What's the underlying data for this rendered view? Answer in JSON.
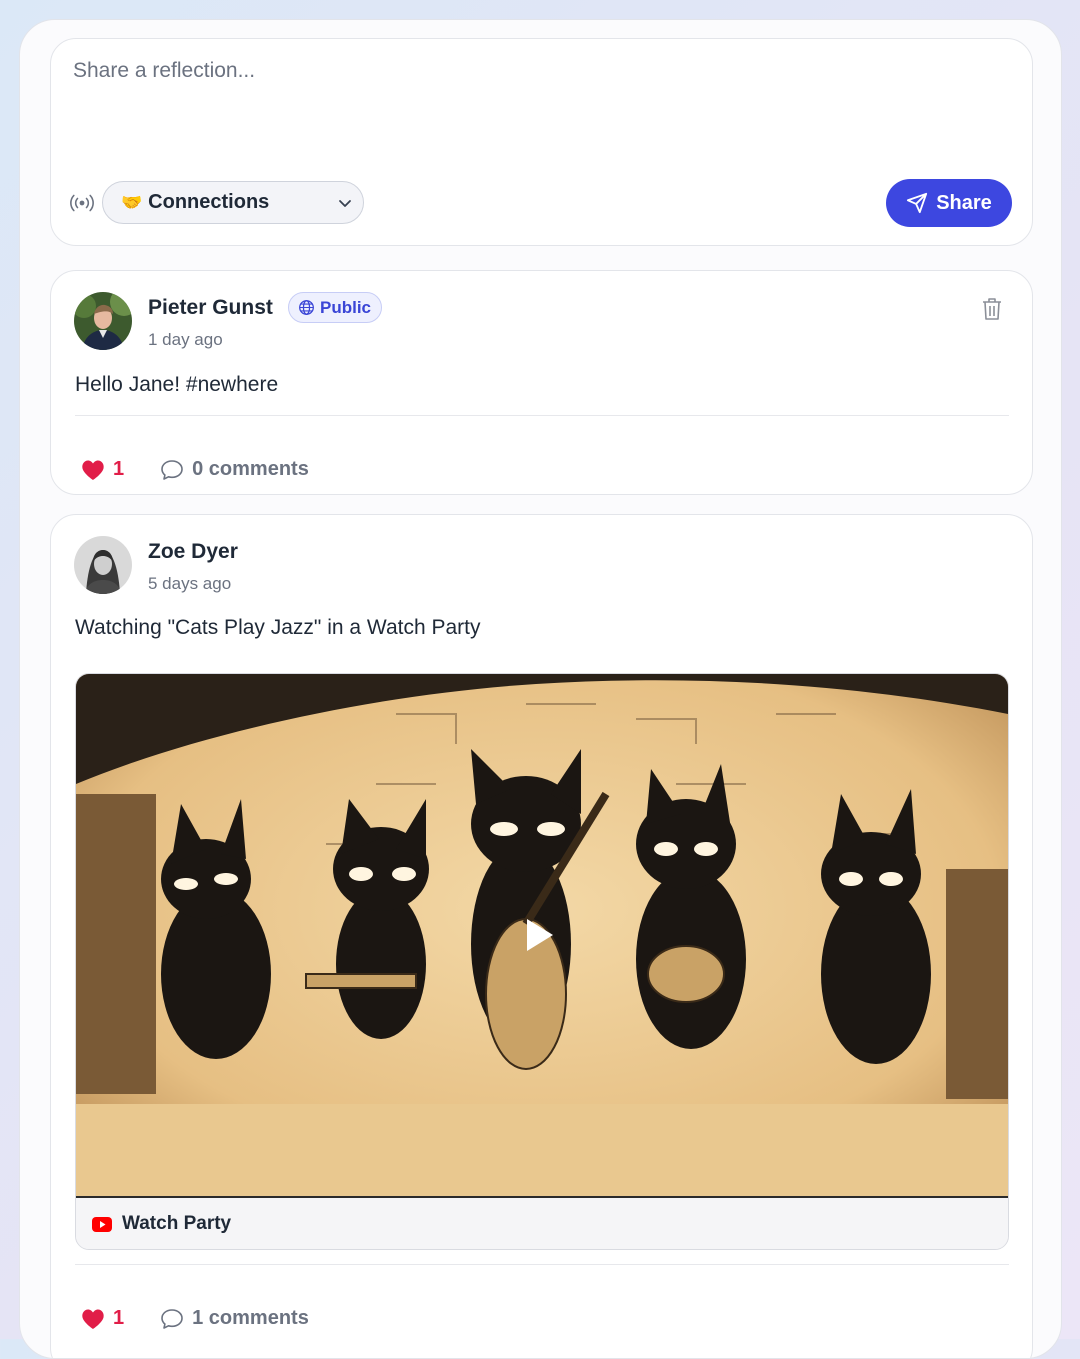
{
  "composer": {
    "placeholder": "Share a reflection...",
    "audience": {
      "emoji": "🤝",
      "label": "Connections"
    },
    "share_label": "Share",
    "accent": "#3d47e0"
  },
  "posts": [
    {
      "author": "Pieter Gunst",
      "badge": "Public",
      "time": "1 day ago",
      "text": "Hello Jane! #newhere",
      "likes": "1",
      "comments": "0 comments"
    },
    {
      "author": "Zoe Dyer",
      "time": "5 days ago",
      "text": "Watching \"Cats Play Jazz\" in a Watch Party",
      "media_label": "Watch Party",
      "likes": "1",
      "comments": "1 comments"
    }
  ],
  "colors": {
    "like": "#e11d48",
    "badge": "#3a45d6",
    "youtube": "#ff0000"
  }
}
